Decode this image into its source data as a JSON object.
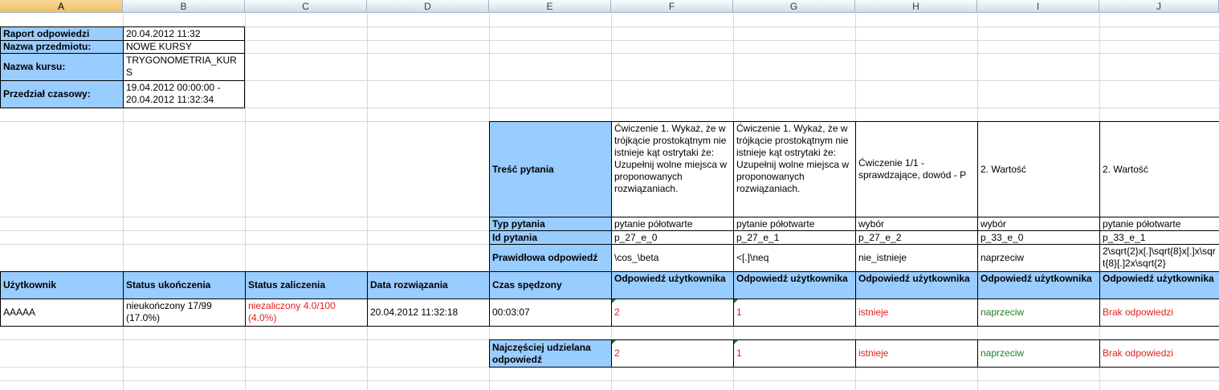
{
  "columns": [
    "A",
    "B",
    "C",
    "D",
    "E",
    "F",
    "G",
    "H",
    "I",
    "J"
  ],
  "header": {
    "report_label": "Raport odpowiedzi",
    "report_value": "20.04.2012 11:32",
    "subject_label": "Nazwa przedmiotu:",
    "subject_value": "NOWE KURSY",
    "course_label": "Nazwa kursu:",
    "course_value": "TRYGONOMETRIA_KURS",
    "range_label": "Przedział czasowy:",
    "range_value": "19.04.2012 00:00:00 - 20.04.2012 11:32:34"
  },
  "questions": {
    "content_label": "Treść pytania",
    "type_label": "Typ pytania",
    "id_label": "Id pytania",
    "correct_label": "Prawidłowa odpowiedź",
    "items": [
      {
        "content": "Ćwiczenie 1. Wykaż, że w trójkącie prostokątnym nie istnieje kąt ostrytaki że: Uzupełnij wolne miejsca w proponowanych rozwiązaniach.",
        "type": "pytanie półotwarte",
        "id": "p_27_e_0",
        "correct": "\\cos_\\beta"
      },
      {
        "content": "Ćwiczenie 1. Wykaż, że w trójkącie prostokątnym nie istnieje kąt ostrytaki że: Uzupełnij wolne miejsca w proponowanych rozwiązaniach.",
        "type": "pytanie półotwarte",
        "id": "p_27_e_1",
        "correct": "<[.]\\neq"
      },
      {
        "content": "Ćwiczenie 1/1 - sprawdzające, dowód - P",
        "type": "wybór",
        "id": "p_27_e_2",
        "correct": "nie_istnieje"
      },
      {
        "content": "2. Wartość",
        "type": "wybór",
        "id": "p_33_e_0",
        "correct": "naprzeciw"
      },
      {
        "content": "2. Wartość",
        "type": "pytanie półotwarte",
        "id": "p_33_e_1",
        "correct": "2\\sqrt{2}x[.]\\sqrt{8}x[.]x\\sqrt{8}[.]2x\\sqrt{2}"
      }
    ]
  },
  "table_headers": {
    "user": "Użytkownik",
    "completion": "Status ukończenia",
    "pass": "Status zaliczenia",
    "date": "Data rozwiązania",
    "time": "Czas spędzony",
    "user_answer": "Odpowiedź użytkownika"
  },
  "row": {
    "user": "AAAAA",
    "completion": "nieukończony 17/99 (17.0%)",
    "pass": "niezaliczony 4.0/100 (4.0%)",
    "date": "20.04.2012 11:32:18",
    "time": "00:03:07",
    "answers": [
      "2",
      "1",
      "istnieje",
      "naprzeciw",
      "Brak odpowiedzi"
    ]
  },
  "most_common": {
    "label": "Najczęściej udzielana odpowiedź",
    "answers": [
      "2",
      "1",
      "istnieje",
      "naprzeciw",
      "Brak odpowiedzi"
    ]
  },
  "colors": {
    "header_fill": "#99ccff",
    "wrong": "#e02020",
    "right": "#208020"
  }
}
